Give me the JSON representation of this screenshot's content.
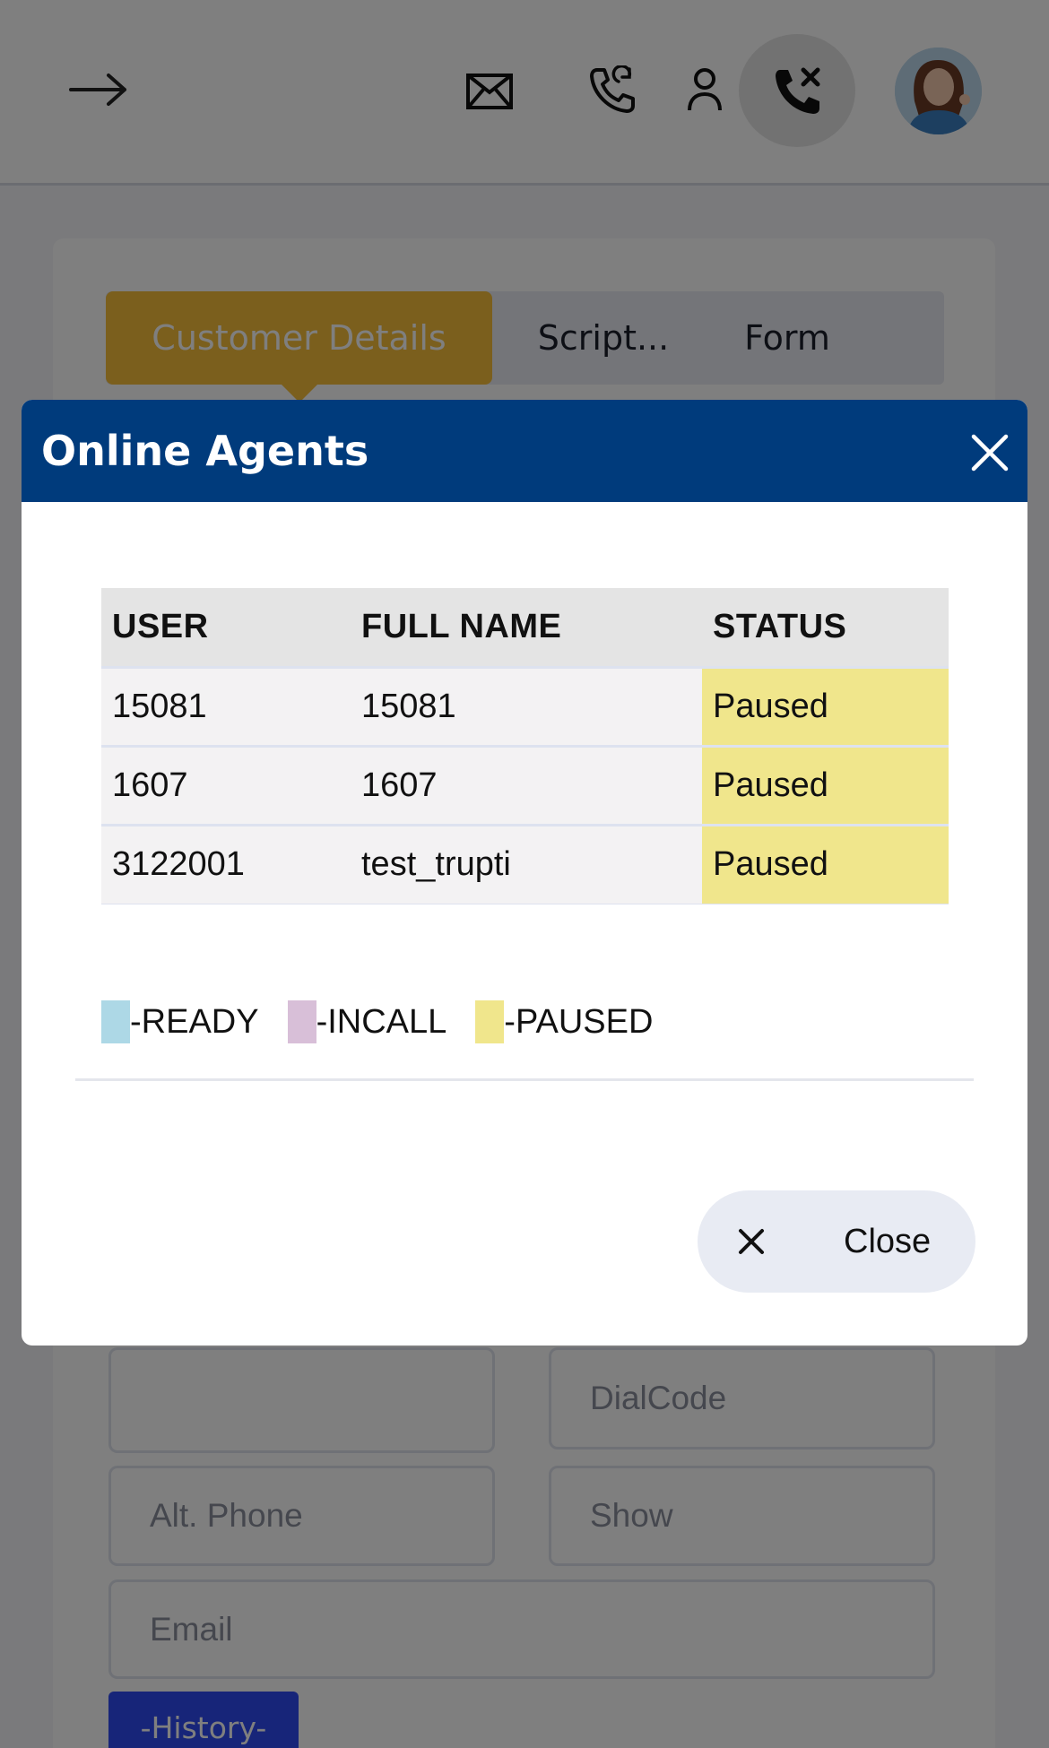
{
  "header": {
    "icons": [
      "arrow-right-icon",
      "mail-icon",
      "incoming-call-icon",
      "user-icon",
      "hangup-call-icon",
      "avatar"
    ]
  },
  "tabs": [
    {
      "label": "Customer Details",
      "active": true
    },
    {
      "label": "Script..."
    },
    {
      "label": "Form"
    }
  ],
  "form": {
    "blank_placeholder": "",
    "dialcode_placeholder": "DialCode",
    "alt_phone_placeholder": "Alt. Phone",
    "show_placeholder": "Show",
    "email_placeholder": "Email",
    "history_label": "-History-"
  },
  "modal": {
    "title": "Online Agents",
    "columns": [
      "USER",
      "FULL NAME",
      "STATUS"
    ],
    "rows": [
      {
        "user": "15081",
        "full_name": "15081",
        "status": "Paused"
      },
      {
        "user": "1607",
        "full_name": "1607",
        "status": "Paused"
      },
      {
        "user": "3122001",
        "full_name": "test_trupti",
        "status": "Paused"
      }
    ],
    "legend": [
      {
        "label": "-READY",
        "color": "#add8e6"
      },
      {
        "label": "-INCALL",
        "color": "#d8bfd8"
      },
      {
        "label": "-PAUSED",
        "color": "#f0e68c"
      }
    ],
    "close_label": "Close"
  },
  "colors": {
    "modal_header": "#003b7c",
    "active_tab": "#f6be3b",
    "history_button": "#2f4bf2",
    "paused": "#f0e68c"
  }
}
